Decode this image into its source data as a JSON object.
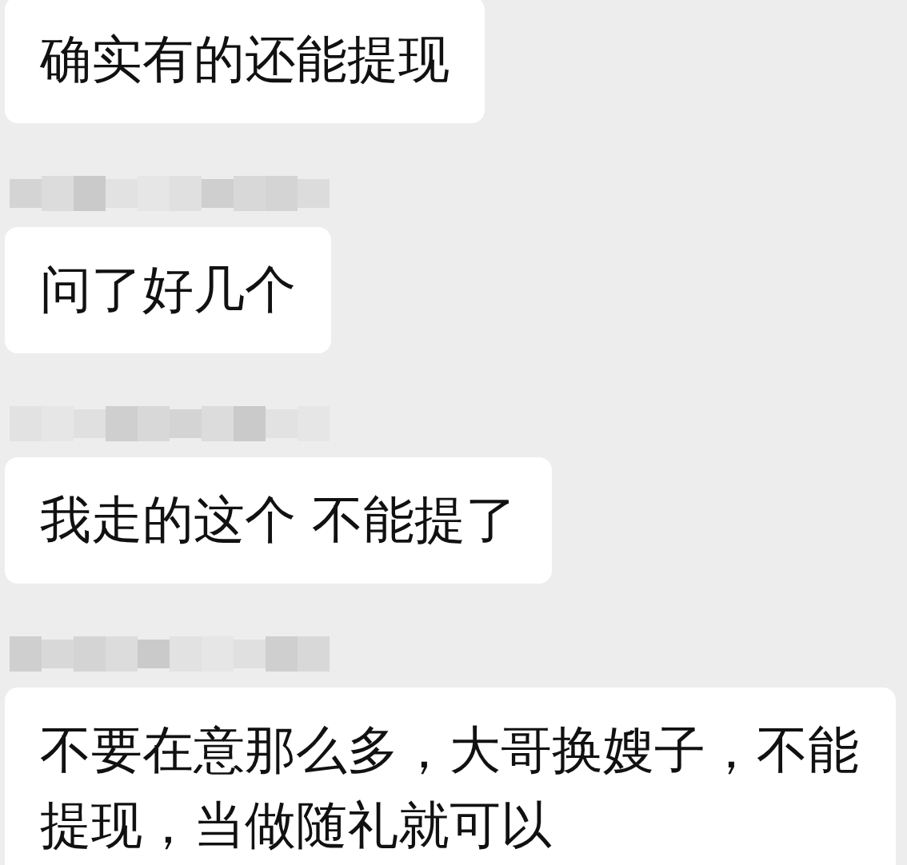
{
  "messages": [
    {
      "kind": "bubble",
      "text": "确实有的还能提现"
    },
    {
      "kind": "blurred-name"
    },
    {
      "kind": "bubble",
      "text": "问了好几个"
    },
    {
      "kind": "blurred-name"
    },
    {
      "kind": "bubble",
      "text": "我走的这个 不能提了"
    },
    {
      "kind": "blurred-name"
    },
    {
      "kind": "bubble",
      "text": "不要在意那么多，大哥换嫂子，不能提现，当做随礼就可以"
    }
  ]
}
